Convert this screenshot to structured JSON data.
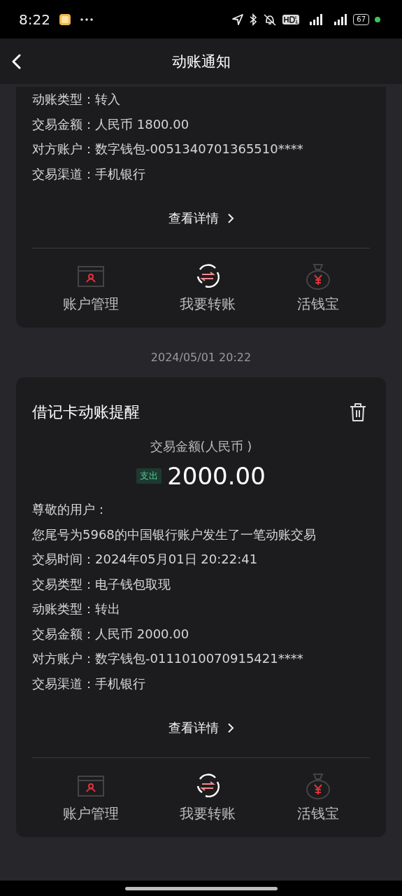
{
  "status_bar": {
    "time": "8:22",
    "battery": "67"
  },
  "header": {
    "title": "动账通知"
  },
  "cards": [
    {
      "partial": true,
      "lines": [
        "动账类型：转入",
        "交易金额：人民币 1800.00",
        "对方账户：数字钱包-0051340701365510****",
        "交易渠道：手机银行"
      ],
      "details_link": "查看详情",
      "actions": [
        {
          "kind": "account",
          "label": "账户管理"
        },
        {
          "kind": "transfer",
          "label": "我要转账"
        },
        {
          "kind": "wallet",
          "label": "活钱宝"
        }
      ]
    },
    {
      "partial": false,
      "date": "2024/05/01 20:22",
      "title": "借记卡动账提醒",
      "amount_caption": "交易金额(人民币 )",
      "direction": "支出",
      "amount": "2000.00",
      "lines": [
        "尊敬的用户：",
        "您尾号为5968的中国银行账户发生了一笔动账交易",
        "交易时间：2024年05月01日 20:22:41",
        "交易类型：电子钱包取现",
        "动账类型：转出",
        "交易金额：人民币 2000.00",
        "对方账户：数字钱包-0111010070915421****",
        "交易渠道：手机银行"
      ],
      "details_link": "查看详情",
      "actions": [
        {
          "kind": "account",
          "label": "账户管理"
        },
        {
          "kind": "transfer",
          "label": "我要转账"
        },
        {
          "kind": "wallet",
          "label": "活钱宝"
        }
      ]
    }
  ]
}
